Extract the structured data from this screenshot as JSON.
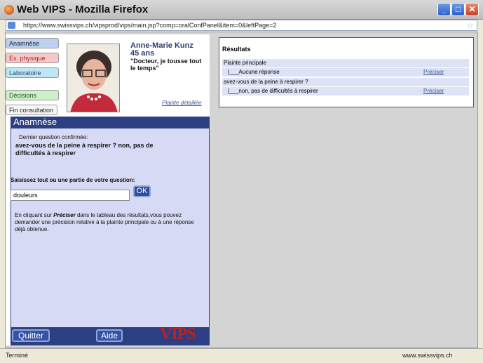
{
  "window": {
    "title": "Web VIPS - Mozilla Firefox"
  },
  "address": {
    "url": "https://www.swissvips.ch/vipsprod/vips/main.jsp?comp=oralConfPanel&item=0&leftPage=2"
  },
  "tabs": [
    {
      "label": "Anamnèse"
    },
    {
      "label": "Ex. physique"
    },
    {
      "label": "Laboratoire"
    },
    {
      "label": "Décisions"
    },
    {
      "label": "Fin consultation"
    }
  ],
  "patient": {
    "name": "Anne-Marie Kunz",
    "age": "45 ans",
    "quote": "\"Docteur, je tousse tout le temps\"",
    "plainte_link": "Plainte détaillée"
  },
  "anamnese": {
    "header": "Anamnèse",
    "last_question_label": "Dernier question confirmée:",
    "last_question_text": "avez-vous de la peine à respirer ? non, pas de difficultés à respirer",
    "prompt_label": "Saisissez tout ou une partie de votre question:",
    "search_value": "douleurs",
    "ok_label": "OK",
    "help_prefix": "En cliquant sur ",
    "help_emph": "Préciser",
    "help_suffix": " dans le tableau des résultats,vous pouvez demander une précision relative à la  plainte principale ou à une réponse déjà obtenue."
  },
  "footer": {
    "quit_label": "Quitter",
    "aide_label": "Aide",
    "logo_text": "VIPS"
  },
  "results": {
    "title": "Résultats",
    "rows": [
      {
        "text": "Plainte principale",
        "link": ""
      },
      {
        "text": "|___Aucune réponse",
        "link": "Préciser"
      },
      {
        "text": "avez-vous de la peine à respirer ?",
        "link": ""
      },
      {
        "text": "|___non, pas de difficultés à respirer",
        "link": "Préciser"
      }
    ]
  },
  "status": {
    "left": "Terminé",
    "right": "www.swissvips.ch"
  },
  "colors": {
    "accent": "#2b3f82",
    "panel": "#d7daf5",
    "link": "#3a5aa0"
  },
  "icons": {
    "app": "firefox-icon",
    "lock": "lock-icon",
    "star": "bookmark-star-icon"
  }
}
